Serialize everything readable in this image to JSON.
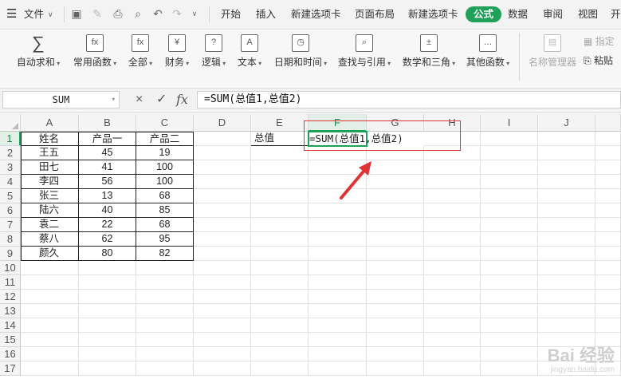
{
  "menubar": {
    "file_label": "文件",
    "tabs": [
      "开始",
      "插入",
      "新建选项卡",
      "页面布局",
      "新建选项卡",
      "公式",
      "数据",
      "审阅",
      "视图",
      "开"
    ],
    "active_tab": "公式",
    "accent_color": "#1fa15a"
  },
  "ribbon": {
    "buttons": [
      {
        "label": "自动求和",
        "icon": "sigma-icon",
        "glyph": "∑"
      },
      {
        "label": "常用函数",
        "icon": "fx-star-icon",
        "glyph": "fx"
      },
      {
        "label": "全部",
        "icon": "fx-icon",
        "glyph": "fx"
      },
      {
        "label": "财务",
        "icon": "yen-book-icon",
        "glyph": "¥"
      },
      {
        "label": "逻辑",
        "icon": "question-book-icon",
        "glyph": "?"
      },
      {
        "label": "文本",
        "icon": "text-book-icon",
        "glyph": "A"
      },
      {
        "label": "日期和时间",
        "icon": "clock-book-icon",
        "glyph": "◷"
      },
      {
        "label": "查找与引用",
        "icon": "search-book-icon",
        "glyph": "⌕"
      },
      {
        "label": "数学和三角",
        "icon": "math-book-icon",
        "glyph": "±"
      },
      {
        "label": "其他函数",
        "icon": "more-book-icon",
        "glyph": "…"
      }
    ],
    "name_manager_label": "名称管理器",
    "assign_label": "指定",
    "paste_label": "粘贴"
  },
  "formula_bar": {
    "name_box": "SUM",
    "cancel_icon": "×",
    "confirm_icon": "✓",
    "fx_label": "fx",
    "formula": "=SUM(总值1,总值2)"
  },
  "grid": {
    "columns": [
      "A",
      "B",
      "C",
      "D",
      "E",
      "F",
      "G",
      "H",
      "I",
      "J"
    ],
    "selected_column": "F",
    "rows": [
      "1",
      "2",
      "3",
      "4",
      "5",
      "6",
      "7",
      "8",
      "9",
      "10",
      "11",
      "12",
      "13",
      "14",
      "15",
      "16",
      "17"
    ],
    "selected_row": "1",
    "table": {
      "headers": [
        "姓名",
        "产品一",
        "产品二"
      ],
      "data": [
        [
          "王五",
          "45",
          "19"
        ],
        [
          "田七",
          "41",
          "100"
        ],
        [
          "李四",
          "56",
          "100"
        ],
        [
          "张三",
          "13",
          "68"
        ],
        [
          "陆六",
          "40",
          "85"
        ],
        [
          "袁二",
          "22",
          "68"
        ],
        [
          "蔡八",
          "62",
          "95"
        ],
        [
          "颜久",
          "80",
          "82"
        ]
      ]
    },
    "e1_label": "总值",
    "f1_editing": "=SUM(总值1,总值2)"
  },
  "watermark": {
    "text": "Bai 经验",
    "sub": "jingyan.baidu.com"
  }
}
